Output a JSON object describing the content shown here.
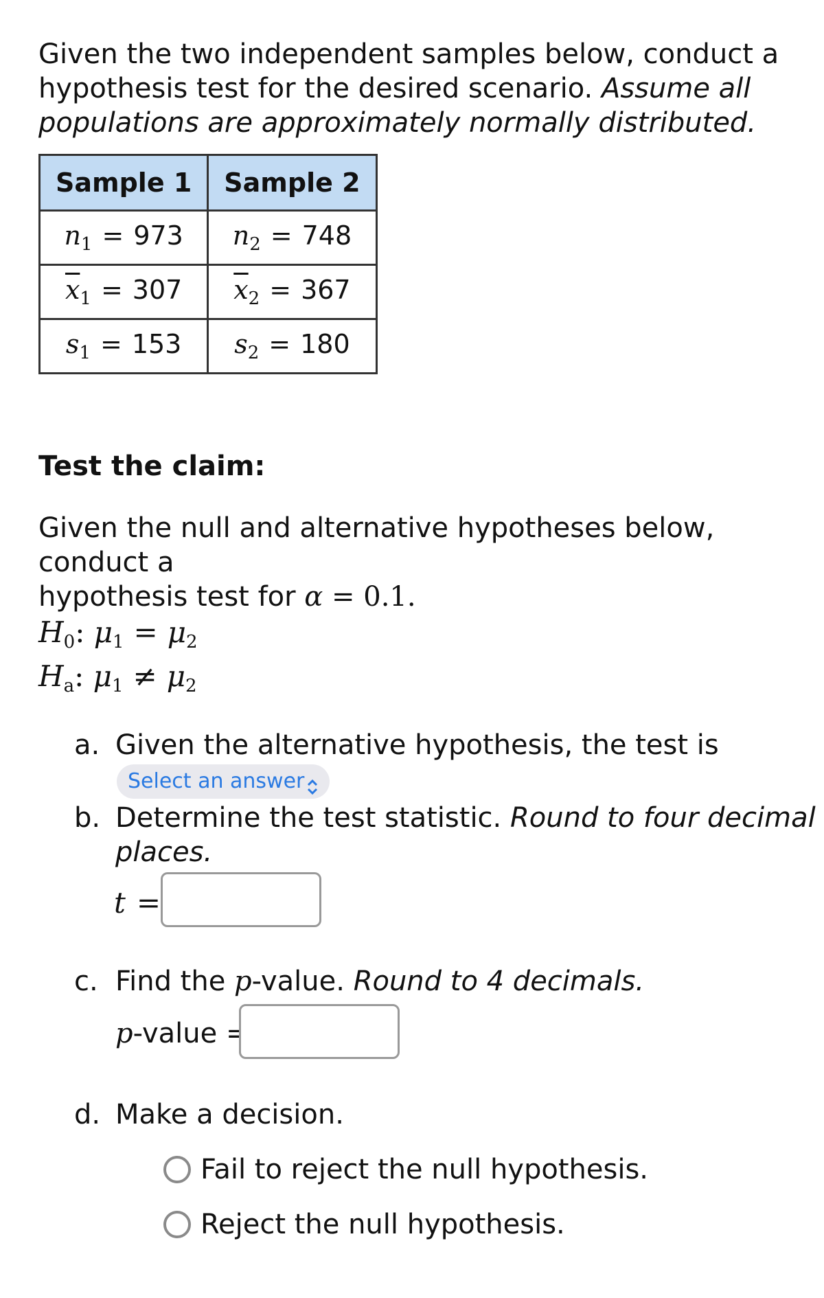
{
  "intro": {
    "line1": "Given the two independent samples below, conduct a",
    "line2_plain": "hypothesis test for the desired scenario. ",
    "line2_italic": "Assume all",
    "line3_italic": "populations are approximately normally distributed."
  },
  "table": {
    "headers": [
      "Sample 1",
      "Sample 2"
    ],
    "rows": [
      {
        "s1_var": "n",
        "s1_sub": "1",
        "s1_val": "973",
        "s2_var": "n",
        "s2_sub": "2",
        "s2_val": "748"
      },
      {
        "s1_var": "x",
        "s1_sub": "1",
        "s1_val": "307",
        "s2_var": "x",
        "s2_sub": "2",
        "s2_val": "367"
      },
      {
        "s1_var": "s",
        "s1_sub": "1",
        "s1_val": "153",
        "s2_var": "s",
        "s2_sub": "2",
        "s2_val": "180"
      }
    ]
  },
  "claim_heading": "Test the claim:",
  "hyp_intro": {
    "line1": "Given the null and alternative hypotheses below, conduct a",
    "line2": "hypothesis test for ",
    "alpha_symbol": "α",
    "alpha_eq": "= 0.1."
  },
  "hypotheses": {
    "null": {
      "label": "H",
      "sub": "0",
      "expr_left": "μ",
      "left_sub": "1",
      "op": "=",
      "expr_right": "μ",
      "right_sub": "2"
    },
    "alt": {
      "label": "H",
      "sub": "a",
      "expr_left": "μ",
      "left_sub": "1",
      "op": "≠",
      "expr_right": "μ",
      "right_sub": "2"
    }
  },
  "parts": {
    "a": {
      "marker": "a.",
      "text": "Given the alternative hypothesis, the test is",
      "select_placeholder": "Select an answer",
      "select_icon": "up-down-chevron-icon"
    },
    "b": {
      "marker": "b.",
      "text": "Determine the test statistic. ",
      "italic1": "Round to four decimal",
      "italic2": "places.",
      "var": "t",
      "eq": "=",
      "value": ""
    },
    "c": {
      "marker": "c.",
      "text1": "Find the ",
      "p": "p",
      "text2": "-value. ",
      "italic": "Round to 4 decimals.",
      "label_p": "p",
      "label_rest": "-value =",
      "value": ""
    },
    "d": {
      "marker": "d.",
      "text": "Make a decision.",
      "options": [
        "Fail to reject the null hypothesis.",
        "Reject the null hypothesis."
      ]
    }
  }
}
